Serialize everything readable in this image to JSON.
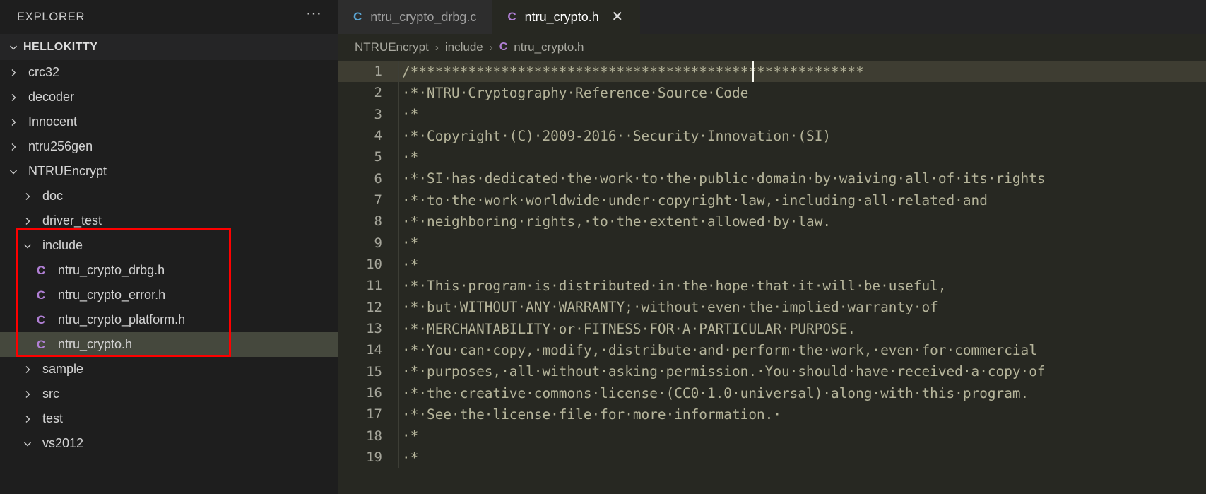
{
  "sidebar": {
    "title": "EXPLORER",
    "more_actions_icon": "ellipsis-icon",
    "root_folder": "HELLOKITTY",
    "tree": [
      {
        "label": "crc32",
        "type": "folder",
        "state": "collapsed",
        "depth": 0
      },
      {
        "label": "decoder",
        "type": "folder",
        "state": "collapsed",
        "depth": 0
      },
      {
        "label": "Innocent",
        "type": "folder",
        "state": "collapsed",
        "depth": 0
      },
      {
        "label": "ntru256gen",
        "type": "folder",
        "state": "collapsed",
        "depth": 0
      },
      {
        "label": "NTRUEncrypt",
        "type": "folder",
        "state": "expanded",
        "depth": 0
      },
      {
        "label": "doc",
        "type": "folder",
        "state": "collapsed",
        "depth": 1
      },
      {
        "label": "driver_test",
        "type": "folder",
        "state": "collapsed",
        "depth": 1
      },
      {
        "label": "include",
        "type": "folder",
        "state": "expanded",
        "depth": 1
      },
      {
        "label": "ntru_crypto_drbg.h",
        "type": "file-h",
        "state": "none",
        "depth": 2
      },
      {
        "label": "ntru_crypto_error.h",
        "type": "file-h",
        "state": "none",
        "depth": 2
      },
      {
        "label": "ntru_crypto_platform.h",
        "type": "file-h",
        "state": "none",
        "depth": 2
      },
      {
        "label": "ntru_crypto.h",
        "type": "file-h",
        "state": "none",
        "depth": 2,
        "selected": true
      },
      {
        "label": "sample",
        "type": "folder",
        "state": "collapsed",
        "depth": 1
      },
      {
        "label": "src",
        "type": "folder",
        "state": "collapsed",
        "depth": 1
      },
      {
        "label": "test",
        "type": "folder",
        "state": "collapsed",
        "depth": 1
      },
      {
        "label": "vs2012",
        "type": "folder",
        "state": "expanded",
        "depth": 1
      }
    ],
    "annotation_color": "#fe0000"
  },
  "tabs": [
    {
      "label": "ntru_crypto_drbg.c",
      "icon": "c-source-icon",
      "icon_kind": "src",
      "active": false,
      "closable": false
    },
    {
      "label": "ntru_crypto.h",
      "icon": "c-header-icon",
      "icon_kind": "hdr",
      "active": true,
      "closable": true,
      "close_glyph": "✕"
    }
  ],
  "breadcrumb": {
    "items": [
      "NTRUEncrypt",
      "include",
      "ntru_crypto.h"
    ],
    "separator": "›",
    "file_icon": "C"
  },
  "editor": {
    "cursor_line": 1,
    "first_line": 1,
    "lines": [
      {
        "n": 1,
        "text": "/*******************************************************"
      },
      {
        "n": 2,
        "text": "·*·NTRU·Cryptography·Reference·Source·Code"
      },
      {
        "n": 3,
        "text": "·*"
      },
      {
        "n": 4,
        "text": "·*·Copyright·(C)·2009-2016··Security·Innovation·(SI)"
      },
      {
        "n": 5,
        "text": "·*"
      },
      {
        "n": 6,
        "text": "·*·SI·has·dedicated·the·work·to·the·public·domain·by·waiving·all·of·its·rights"
      },
      {
        "n": 7,
        "text": "·*·to·the·work·worldwide·under·copyright·law,·including·all·related·and"
      },
      {
        "n": 8,
        "text": "·*·neighboring·rights,·to·the·extent·allowed·by·law."
      },
      {
        "n": 9,
        "text": "·*"
      },
      {
        "n": 10,
        "text": "·*"
      },
      {
        "n": 11,
        "text": "·*·This·program·is·distributed·in·the·hope·that·it·will·be·useful,"
      },
      {
        "n": 12,
        "text": "·*·but·WITHOUT·ANY·WARRANTY;·without·even·the·implied·warranty·of"
      },
      {
        "n": 13,
        "text": "·*·MERCHANTABILITY·or·FITNESS·FOR·A·PARTICULAR·PURPOSE."
      },
      {
        "n": 14,
        "text": "·*·You·can·copy,·modify,·distribute·and·perform·the·work,·even·for·commercial"
      },
      {
        "n": 15,
        "text": "·*·purposes,·all·without·asking·permission.·You·should·have·received·a·copy·of"
      },
      {
        "n": 16,
        "text": "·*·the·creative·commons·license·(CC0·1.0·universal)·along·with·this·program."
      },
      {
        "n": 17,
        "text": "·*·See·the·license·file·for·more·information.·"
      },
      {
        "n": 18,
        "text": "·*"
      },
      {
        "n": 19,
        "text": "·*"
      }
    ]
  },
  "colors": {
    "sidebar_bg": "#1e1e1e",
    "editor_bg": "#272822",
    "tab_inactive_bg": "#2d2d2d",
    "selection_bg": "#45483d",
    "current_line_bg": "#3e3d32",
    "comment_text": "#b5b49a",
    "header_icon": "#b07fd4",
    "source_icon": "#5ba7d6",
    "annotation": "#fe0000"
  }
}
